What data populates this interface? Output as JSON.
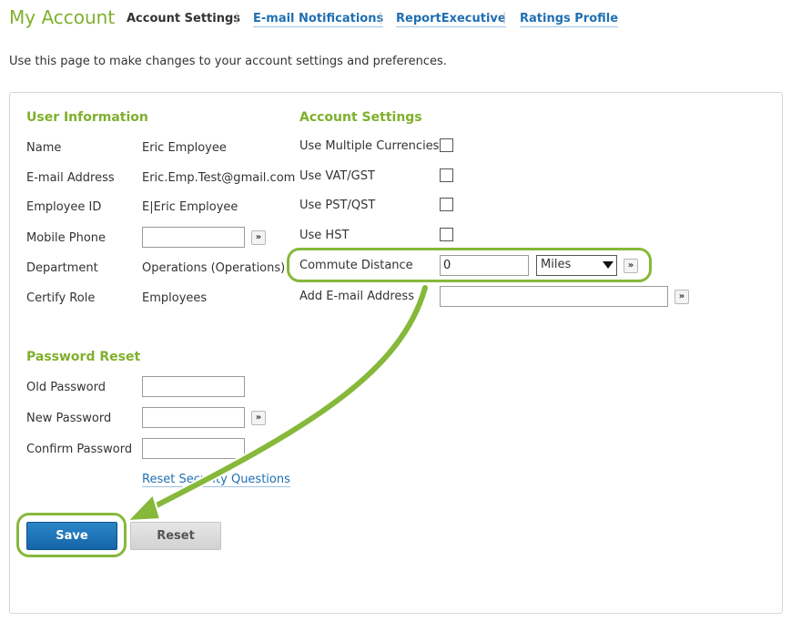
{
  "header": {
    "title": "My Account",
    "tabs": [
      {
        "label": "Account Settings",
        "active": true
      },
      {
        "label": "E-mail Notifications",
        "active": false
      },
      {
        "label": "ReportExecutive",
        "active": false
      },
      {
        "label": "Ratings Profile",
        "active": false
      }
    ],
    "separator": "|"
  },
  "intro": "Use this page to make changes to your account settings and preferences.",
  "user_info": {
    "heading": "User Information",
    "name_label": "Name",
    "name_value": "Eric Employee",
    "email_label": "E-mail Address",
    "email_value": "Eric.Emp.Test@gmail.com",
    "employee_id_label": "Employee ID",
    "employee_id_value": "E|Eric Employee",
    "mobile_label": "Mobile Phone",
    "mobile_value": "",
    "department_label": "Department",
    "department_value": "Operations (Operations)",
    "certify_label": "Certify Role",
    "certify_value": "Employees"
  },
  "password_reset": {
    "heading": "Password Reset",
    "old_label": "Old Password",
    "new_label": "New Password",
    "confirm_label": "Confirm Password",
    "reset_questions_link": "Reset Security Questions"
  },
  "account_settings": {
    "heading": "Account Settings",
    "multi_currency_label": "Use Multiple Currencies",
    "vat_label": "Use VAT/GST",
    "pst_label": "Use PST/QST",
    "hst_label": "Use HST",
    "commute_label": "Commute Distance",
    "commute_value": "0",
    "commute_unit": "Miles",
    "add_email_label": "Add E-mail Address",
    "add_email_value": ""
  },
  "go_glyph": "»",
  "buttons": {
    "save": "Save",
    "reset": "Reset"
  },
  "colors": {
    "accent_green": "#7fb02c",
    "link_blue": "#1f6fb2",
    "save_blue": "#1a72b8",
    "highlight_green": "#86b83a"
  }
}
